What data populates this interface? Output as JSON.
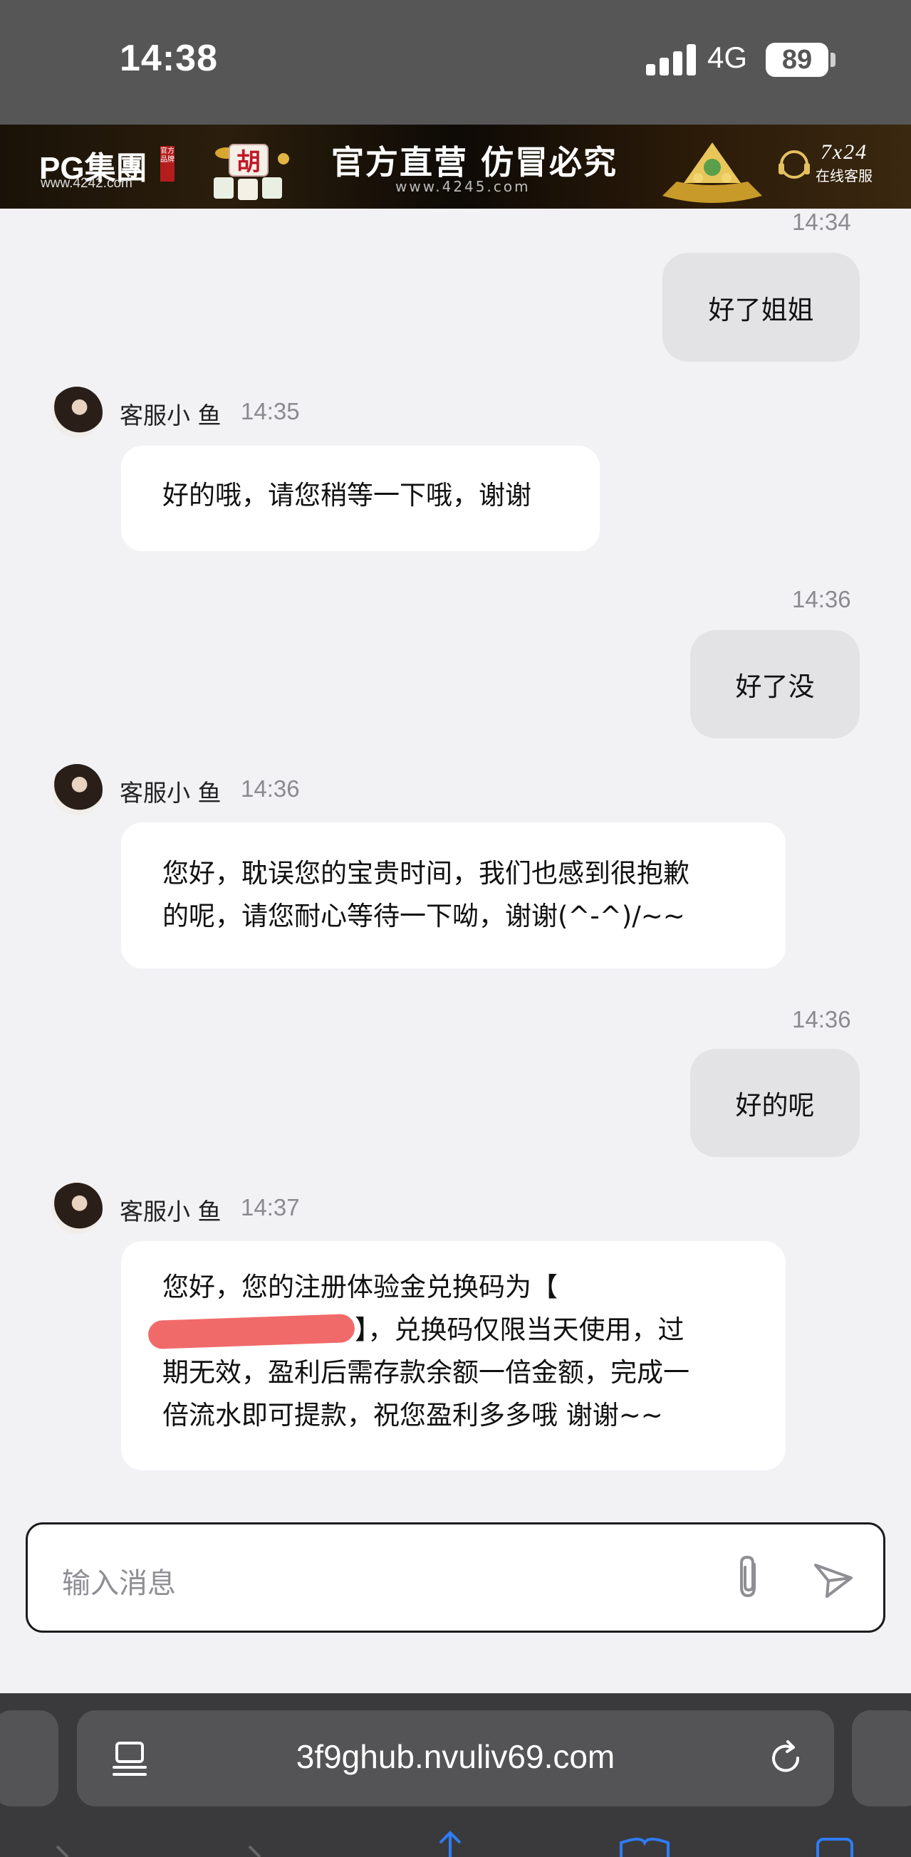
{
  "status_bar": {
    "time": "14:38",
    "network": "4G",
    "battery": "89"
  },
  "banner": {
    "logo": "PG集團",
    "logo_url": "www.4242.com",
    "logo_badge": "官方品牌",
    "slogan": "官方直营 仿冒必究",
    "site_url": "www.4245.com",
    "support_hours": "7x24",
    "support_label": "在线客服"
  },
  "chat": {
    "messages": [
      {
        "from": "me",
        "time": "14:34",
        "text": "好了姐姐"
      },
      {
        "from": "agent",
        "name": "客服小 鱼",
        "time": "14:35",
        "text": "好的哦，请您稍等一下哦，谢谢"
      },
      {
        "from": "me",
        "time": "14:36",
        "text": "好了没"
      },
      {
        "from": "agent",
        "name": "客服小 鱼",
        "time": "14:36",
        "lines": [
          "您好，耽误您的宝贵时间，我们也感到很抱歉",
          "的呢，请您耐心等待一下呦，谢谢(^-^)/~~"
        ]
      },
      {
        "from": "me",
        "time": "14:36",
        "text": "好的呢"
      },
      {
        "from": "agent",
        "name": "客服小 鱼",
        "time": "14:37",
        "lines": [
          "您好，您的注册体验金兑换码为【",
          "】，兑换码仅限当天使用，过",
          "期无效，盈利后需存款余额一倍金额，完成一",
          "倍流水即可提款，祝您盈利多多哦 谢谢~~"
        ]
      }
    ]
  },
  "input": {
    "placeholder": "输入消息"
  },
  "browser": {
    "url": "3f9ghub.nvuliv69.com"
  },
  "colors": {
    "status_bg": "#565657",
    "page_bg": "#f2f2f5",
    "my_bubble": "#e3e3e6",
    "agent_bubble": "#ffffff",
    "redaction": "#f16a6a",
    "browser_bg": "#3a3a3c"
  }
}
